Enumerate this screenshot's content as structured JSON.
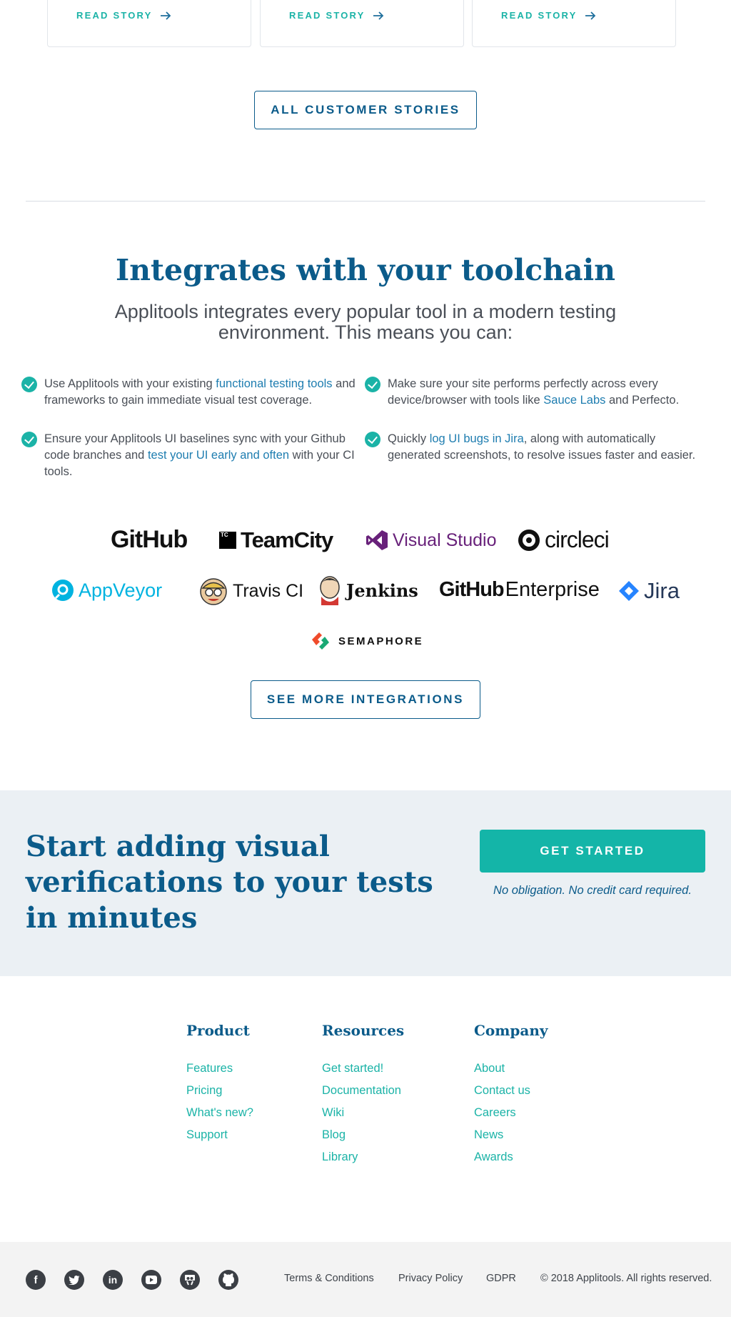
{
  "stories": {
    "cards": [
      {
        "read_label": "READ STORY"
      },
      {
        "read_label": "READ STORY"
      },
      {
        "read_label": "READ STORY"
      }
    ],
    "all_button": "ALL CUSTOMER STORIES"
  },
  "integrations": {
    "title": "Integrates with your toolchain",
    "lead": "Applitools integrates every popular tool in a modern testing environment. This means you can:",
    "bullets": [
      {
        "pre": "Use Applitools with your existing ",
        "link": "functional testing tools",
        "post": " and frameworks to gain immediate visual test coverage."
      },
      {
        "pre": "Make sure your site performs perfectly across every device/browser with tools like ",
        "link": "Sauce Labs",
        "post": " and Perfecto."
      },
      {
        "pre": "Ensure your Applitools UI baselines sync with your Github code branches and ",
        "link": "test your UI early and often",
        "post": " with your CI tools."
      },
      {
        "pre": "Quickly ",
        "link": "log UI bugs in Jira",
        "post": ", along with automatically generated screenshots, to resolve issues faster and easier."
      }
    ],
    "logos": {
      "github": "GitHub",
      "teamcity": "TeamCity",
      "teamcity_badge": "TC",
      "visualstudio": "Visual Studio",
      "circleci": "circleci",
      "appveyor": "AppVeyor",
      "travis": "Travis CI",
      "jenkins": "Jenkins",
      "github_ent_1": "GitHub",
      "github_ent_2": "Enterprise",
      "jira": "Jira",
      "semaphore": "SEMAPHORE"
    },
    "more_button": "SEE MORE INTEGRATIONS"
  },
  "cta": {
    "title": "Start adding visual verifications to your tests in minutes",
    "button": "GET STARTED",
    "note": "No obligation. No credit card required."
  },
  "footer": {
    "product": {
      "heading": "Product",
      "links": [
        "Features",
        "Pricing",
        "What's new?",
        "Support"
      ]
    },
    "resources": {
      "heading": "Resources",
      "links": [
        "Get started!",
        "Documentation",
        "Wiki",
        "Blog",
        "Library"
      ]
    },
    "company": {
      "heading": "Company",
      "links": [
        "About",
        "Contact us",
        "Careers",
        "News",
        "Awards"
      ]
    },
    "social_icons": [
      "facebook-icon",
      "twitter-icon",
      "linkedin-icon",
      "youtube-icon",
      "slideshare-icon",
      "github-icon"
    ],
    "legal": {
      "terms": "Terms & Conditions",
      "privacy": "Privacy Policy",
      "gdpr": "GDPR",
      "copyright": "© 2018 Applitools. All rights reserved."
    }
  },
  "colors": {
    "brand_blue": "#0b5b8a",
    "teal": "#1bb3a7",
    "cta_bg": "#ebf0f4"
  }
}
